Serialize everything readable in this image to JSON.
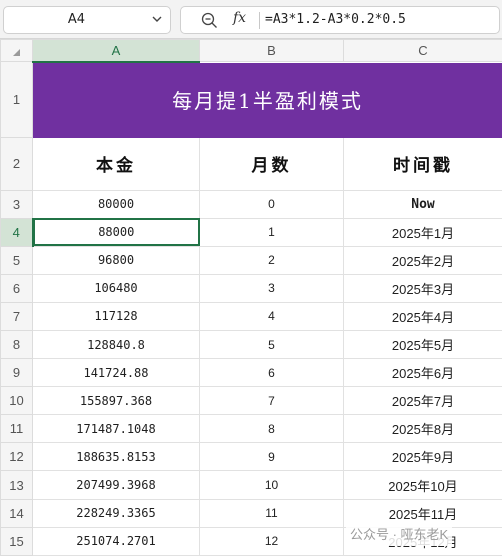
{
  "formula_bar": {
    "cell_ref": "A4",
    "fx_label": "fx",
    "formula": "=A3*1.2-A3*0.2*0.5"
  },
  "columns": [
    "A",
    "B",
    "C"
  ],
  "title": "每月提1半盈利模式",
  "headers": {
    "principal": "本金",
    "months": "月数",
    "timestamp": "时间戳"
  },
  "rows": [
    {
      "n": "1"
    },
    {
      "n": "2"
    },
    {
      "n": "3",
      "principal": "80000",
      "months": "0",
      "timestamp": "Now"
    },
    {
      "n": "4",
      "principal": "88000",
      "months": "1",
      "timestamp": "2025年1月"
    },
    {
      "n": "5",
      "principal": "96800",
      "months": "2",
      "timestamp": "2025年2月"
    },
    {
      "n": "6",
      "principal": "106480",
      "months": "3",
      "timestamp": "2025年3月"
    },
    {
      "n": "7",
      "principal": "117128",
      "months": "4",
      "timestamp": "2025年4月"
    },
    {
      "n": "8",
      "principal": "128840.8",
      "months": "5",
      "timestamp": "2025年5月"
    },
    {
      "n": "9",
      "principal": "141724.88",
      "months": "6",
      "timestamp": "2025年6月"
    },
    {
      "n": "10",
      "principal": "155897.368",
      "months": "7",
      "timestamp": "2025年7月"
    },
    {
      "n": "11",
      "principal": "171487.1048",
      "months": "8",
      "timestamp": "2025年8月"
    },
    {
      "n": "12",
      "principal": "188635.8153",
      "months": "9",
      "timestamp": "2025年9月"
    },
    {
      "n": "13",
      "principal": "207499.3968",
      "months": "10",
      "timestamp": "2025年10月"
    },
    {
      "n": "14",
      "principal": "228249.3365",
      "months": "11",
      "timestamp": "2025年11月"
    },
    {
      "n": "15",
      "principal": "251074.2701",
      "months": "12",
      "timestamp": "2025年12月"
    }
  ],
  "watermark": "公众号 · 哑东老K",
  "colors": {
    "banner": "#7030a0",
    "selection": "#217346",
    "header_bg": "#f5f5f5"
  }
}
